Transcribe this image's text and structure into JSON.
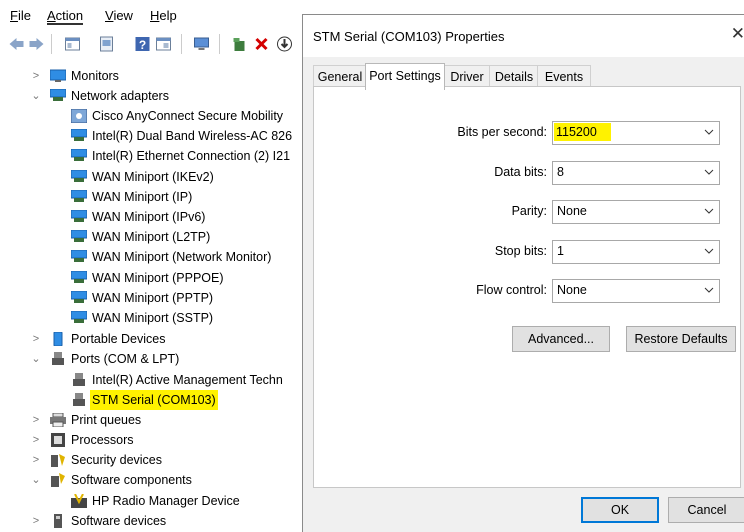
{
  "menubar": [
    {
      "label": "File",
      "ul": "F",
      "rest": "ile"
    },
    {
      "label": "Action",
      "ul": "A",
      "rest": "ction"
    },
    {
      "label": "View",
      "ul": "V",
      "rest": "iew"
    },
    {
      "label": "Help",
      "ul": "H",
      "rest": "elp"
    }
  ],
  "tree": {
    "monitors": "Monitors",
    "network_adapters": "Network adapters",
    "adapters": [
      "Cisco AnyConnect Secure Mobility",
      "Intel(R) Dual Band Wireless-AC 826",
      "Intel(R) Ethernet Connection (2) I21",
      "WAN Miniport (IKEv2)",
      "WAN Miniport (IP)",
      "WAN Miniport (IPv6)",
      "WAN Miniport (L2TP)",
      "WAN Miniport (Network Monitor)",
      "WAN Miniport (PPPOE)",
      "WAN Miniport (PPTP)",
      "WAN Miniport (SSTP)"
    ],
    "portable_devices": "Portable Devices",
    "ports": "Ports (COM & LPT)",
    "port_items": [
      "Intel(R) Active Management Techn",
      "STM Serial (COM103)"
    ],
    "print_queues": "Print queues",
    "processors": "Processors",
    "security_devices": "Security devices",
    "software_components": "Software components",
    "hp_radio": "HP Radio Manager Device",
    "software_devices": "Software devices"
  },
  "dialog": {
    "title": "STM Serial (COM103) Properties",
    "close": "✕",
    "tabs": [
      "General",
      "Port Settings",
      "Driver",
      "Details",
      "Events"
    ],
    "selected_tab": "Port Settings",
    "fields": {
      "bits_per_second": {
        "label": "Bits per second:",
        "value": "115200"
      },
      "data_bits": {
        "label": "Data bits:",
        "value": "8"
      },
      "parity": {
        "label": "Parity:",
        "value": "None"
      },
      "stop_bits": {
        "label": "Stop bits:",
        "value": "1"
      },
      "flow_control": {
        "label": "Flow control:",
        "value": "None"
      }
    },
    "advanced_button": "Advanced...",
    "restore_button": "Restore Defaults",
    "ok_button": "OK",
    "cancel_button": "Cancel"
  },
  "colors": {
    "highlight": "#fff200",
    "accent": "#0078d7"
  }
}
